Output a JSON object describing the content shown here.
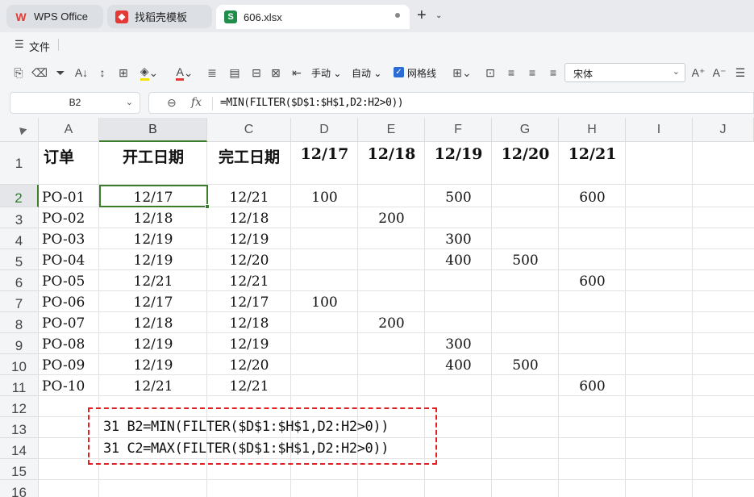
{
  "tabs": [
    {
      "label": "WPS Office",
      "logo": "W",
      "color": "#e53935"
    },
    {
      "label": "找稻壳模板",
      "logo": "稻",
      "color": "#e53935"
    },
    {
      "label": "606.xlsx",
      "logo": "S",
      "color": "#1e8e4a"
    }
  ],
  "menu": {
    "file_label": "文件"
  },
  "toolbar": {
    "row_height_label": "手动",
    "col_width_label": "自动",
    "gridlines_label": "网格线",
    "font_name": "宋体"
  },
  "formula_bar": {
    "cell_ref": "B2",
    "formula": "=MIN(FILTER($D$1:$H$1,D2:H2>0))"
  },
  "columns": [
    "A",
    "B",
    "C",
    "D",
    "E",
    "F",
    "G",
    "H",
    "I",
    "J"
  ],
  "rows": [
    "1",
    "2",
    "3",
    "4",
    "5",
    "6",
    "7",
    "8",
    "9",
    "10",
    "11",
    "12",
    "13",
    "14",
    "15",
    "16"
  ],
  "header_row": [
    "订单",
    "开工日期",
    "完工日期",
    "12/17",
    "12/18",
    "12/19",
    "12/20",
    "12/21"
  ],
  "data_rows": [
    [
      "PO-01",
      "12/17",
      "12/21",
      "100",
      "",
      "500",
      "",
      "600"
    ],
    [
      "PO-02",
      "12/18",
      "12/18",
      "",
      "200",
      "",
      "",
      ""
    ],
    [
      "PO-03",
      "12/19",
      "12/19",
      "",
      "",
      "300",
      "",
      ""
    ],
    [
      "PO-04",
      "12/19",
      "12/20",
      "",
      "",
      "400",
      "500",
      ""
    ],
    [
      "PO-05",
      "12/21",
      "12/21",
      "",
      "",
      "",
      "",
      "600"
    ],
    [
      "PO-06",
      "12/17",
      "12/17",
      "100",
      "",
      "",
      "",
      ""
    ],
    [
      "PO-07",
      "12/18",
      "12/18",
      "",
      "200",
      "",
      "",
      ""
    ],
    [
      "PO-08",
      "12/19",
      "12/19",
      "",
      "",
      "300",
      "",
      ""
    ],
    [
      "PO-09",
      "12/19",
      "12/20",
      "",
      "",
      "400",
      "500",
      ""
    ],
    [
      "PO-10",
      "12/21",
      "12/21",
      "",
      "",
      "",
      "",
      "600"
    ]
  ],
  "notes": [
    "31 B2=MIN(FILTER($D$1:$H$1,D2:H2>0))",
    "31 C2=MAX(FILTER($D$1:$H$1,D2:H2>0))"
  ]
}
